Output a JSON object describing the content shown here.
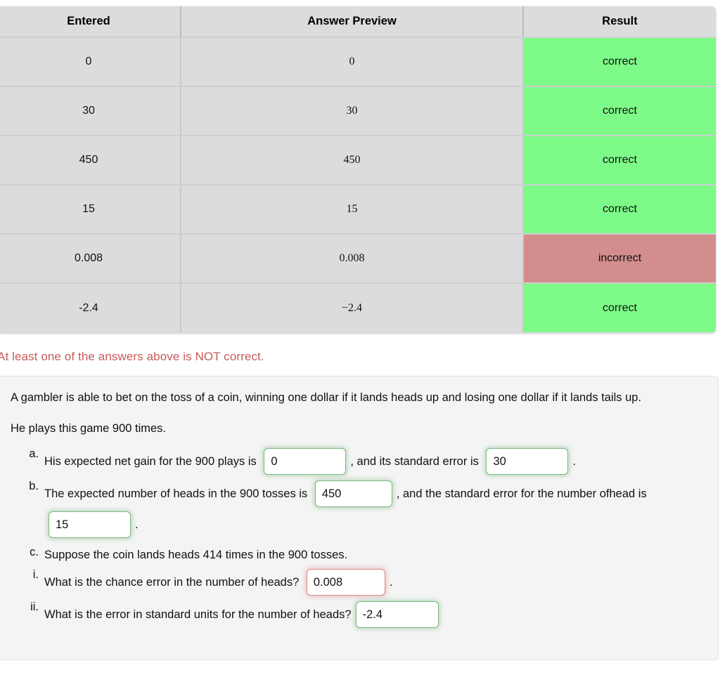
{
  "results_table": {
    "columns": [
      "Entered",
      "Answer Preview",
      "Result"
    ],
    "rows": [
      {
        "entered": "0",
        "preview": "0",
        "result": "correct",
        "status": "correct"
      },
      {
        "entered": "30",
        "preview": "30",
        "result": "correct",
        "status": "correct"
      },
      {
        "entered": "450",
        "preview": "450",
        "result": "correct",
        "status": "correct"
      },
      {
        "entered": "15",
        "preview": "15",
        "result": "correct",
        "status": "correct"
      },
      {
        "entered": "0.008",
        "preview": "0.008",
        "result": "incorrect",
        "status": "incorrect"
      },
      {
        "entered": "-2.4",
        "preview": "−2.4",
        "result": "correct",
        "status": "correct"
      }
    ],
    "colors": {
      "correct_bg": "#7dfa88",
      "incorrect_bg": "#d28d8d",
      "result_text": "#191970",
      "cell_bg": "#dcdcdc"
    }
  },
  "error_message": {
    "text": "At least one of the answers above is NOT correct.",
    "color": "#c75b5b"
  },
  "problem": {
    "paragraph_1": "A gambler is able to bet on the toss of a coin, winning one dollar if it lands heads up and losing one dollar if it lands tails up.",
    "paragraph_2": "He plays this game 900 times.",
    "parts": [
      {
        "marker": "a.",
        "segments": [
          "His expected net gain for the 900 plays is ",
          ", and its standard error is ",
          "."
        ],
        "inputs": [
          {
            "value": "0",
            "state": "correct"
          },
          {
            "value": "30",
            "state": "correct"
          }
        ]
      },
      {
        "marker": "b.",
        "segments": [
          "The expected number of heads in the 900 tosses is ",
          ", and the standard error for the number of",
          "head is ",
          "."
        ],
        "inputs": [
          {
            "value": "450",
            "state": "correct"
          },
          {
            "value": "15",
            "state": "correct"
          }
        ]
      },
      {
        "marker": "c.",
        "segments": [
          "Suppose the coin lands heads 414 times in the 900 tosses."
        ],
        "inputs": []
      },
      {
        "marker": "i.",
        "segments": [
          "What is the chance error in the number of heads? ",
          "."
        ],
        "inputs": [
          {
            "value": "0.008",
            "state": "incorrect"
          }
        ]
      },
      {
        "marker": "ii.",
        "segments": [
          "What is the error in standard units for the number of heads?"
        ],
        "inputs": [
          {
            "value": "-2.4",
            "state": "correct"
          }
        ]
      }
    ]
  }
}
